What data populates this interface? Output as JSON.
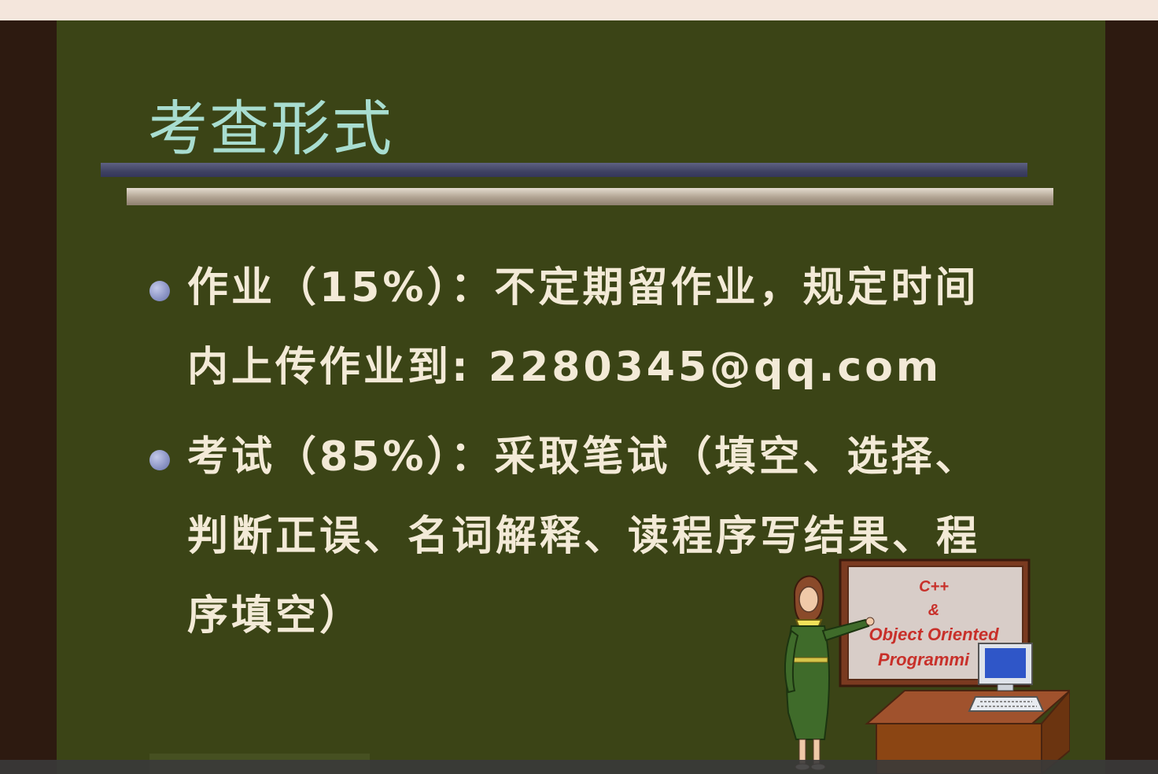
{
  "slide": {
    "title": "考查形式",
    "bullets": [
      {
        "line1": "作业（15%）：不定期留作业，规定时间",
        "line2": "内上传作业到: 2280345@qq.com"
      },
      {
        "line1": "考试（85%）：采取笔试（填空、选择、",
        "line2": "判断正误、名词解释、读程序写结果、程",
        "line3": "序填空）"
      }
    ],
    "clipart": {
      "board_line1": "C++",
      "board_line2": "&",
      "board_line3": "Object Oriented",
      "board_line4": "Programmi"
    }
  },
  "colors": {
    "slide_bg": "#3b4416",
    "frame": "#2d1a10",
    "title": "#a8ddd0",
    "text": "#f3ead7",
    "bullet": "#8a93c4"
  }
}
